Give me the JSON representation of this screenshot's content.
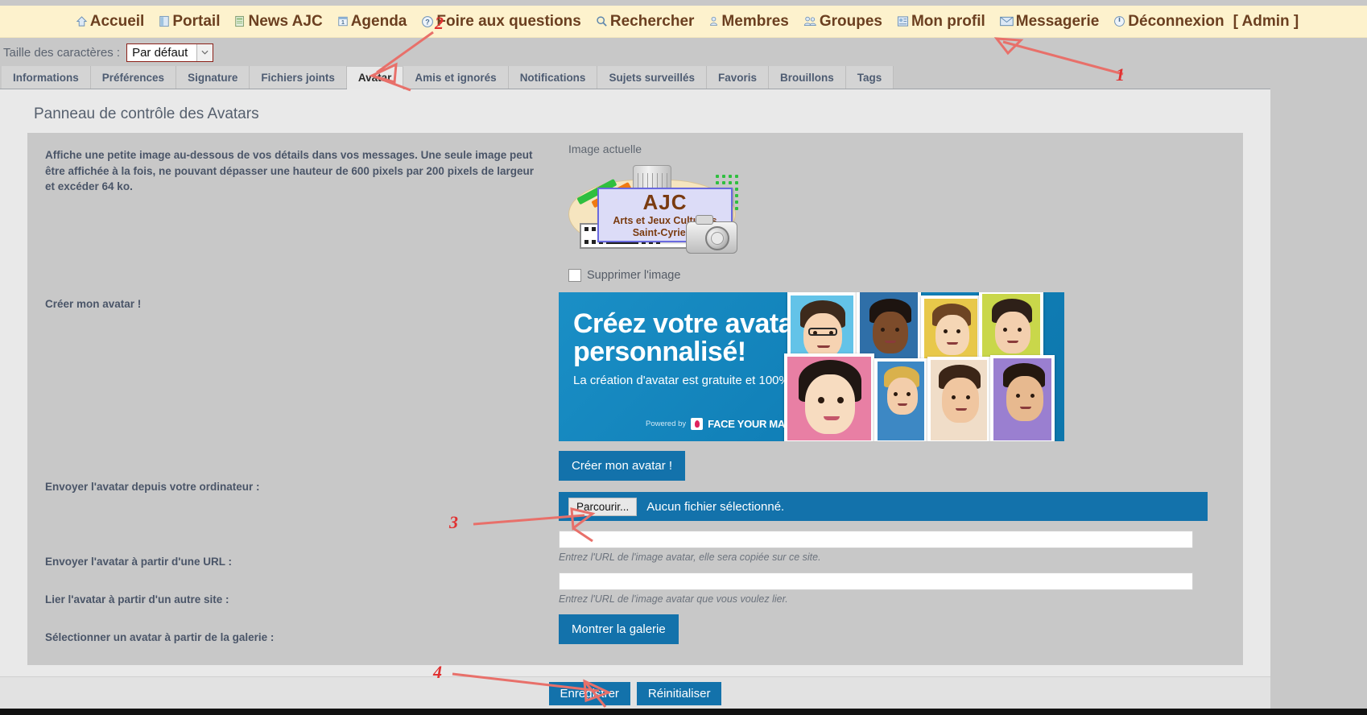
{
  "main_nav": {
    "items": [
      {
        "label": "Accueil",
        "icon": "home-icon",
        "active": false
      },
      {
        "label": "Portail",
        "icon": "portal-icon",
        "active": false
      },
      {
        "label": "News AJC",
        "icon": "news-icon",
        "active": false
      },
      {
        "label": "Agenda",
        "icon": "calendar-icon",
        "active": false
      },
      {
        "label": "Foire aux questions",
        "icon": "question-icon",
        "active": false
      },
      {
        "label": "Rechercher",
        "icon": "search-icon",
        "active": false
      },
      {
        "label": "Membres",
        "icon": "member-icon",
        "active": false
      },
      {
        "label": "Groupes",
        "icon": "groups-icon",
        "active": false
      },
      {
        "label": "Mon profil",
        "icon": "profile-icon",
        "active": true
      },
      {
        "label": "Messagerie",
        "icon": "envelope-icon",
        "active": false
      },
      {
        "label": "Déconnexion",
        "icon": "power-icon",
        "active": false
      }
    ],
    "admin_tag": "[ Admin ]"
  },
  "font_size": {
    "label": "Taille des caractères :",
    "selected": "Par défaut"
  },
  "tabs": [
    {
      "label": "Informations",
      "active": false
    },
    {
      "label": "Préférences",
      "active": false
    },
    {
      "label": "Signature",
      "active": false
    },
    {
      "label": "Fichiers joints",
      "active": false
    },
    {
      "label": "Avatar",
      "active": true
    },
    {
      "label": "Amis et ignorés",
      "active": false
    },
    {
      "label": "Notifications",
      "active": false
    },
    {
      "label": "Sujets surveillés",
      "active": false
    },
    {
      "label": "Favoris",
      "active": false
    },
    {
      "label": "Brouillons",
      "active": false
    },
    {
      "label": "Tags",
      "active": false
    }
  ],
  "page": {
    "title": "Panneau de contrôle des Avatars",
    "info_text": "Affiche une petite image au-dessous de vos détails dans vos messages. Une seule image peut être affichée à la fois, ne pouvant dépasser une hauteur de 600 pixels par 200 pixels de largeur et excéder 64 ko."
  },
  "avatar": {
    "current_label": "Image actuelle",
    "image_alt": "AJC - Arts et Jeux Culturels Saint-Cyriens",
    "logo_line1": "AJC",
    "logo_line2": "Arts et Jeux Culturels",
    "logo_line3": "Saint-Cyriens",
    "delete_checkbox_label": "Supprimer l'image",
    "delete_checked": false
  },
  "banner": {
    "headline_line1": "Créez votre avatar",
    "headline_line2": "personnalisé!",
    "subline": "La création d'avatar est gratuite et 100% Fun",
    "powered_by": "Powered by",
    "brand": "FACE YOUR MANGA",
    "bg_color": "#1180b8"
  },
  "form": {
    "create_avatar_label": "Créer mon avatar !",
    "create_avatar_button": "Créer mon avatar !",
    "upload_computer_label": "Envoyer l'avatar depuis votre ordinateur :",
    "browse_button": "Parcourir...",
    "file_status": "Aucun fichier sélectionné.",
    "upload_url_label": "Envoyer l'avatar à partir d'une URL :",
    "upload_url_value": "",
    "upload_url_hint": "Entrez l'URL de l'image avatar, elle sera copiée sur ce site.",
    "link_url_label": "Lier l'avatar à partir d'un autre site :",
    "link_url_value": "",
    "link_url_hint": "Entrez l'URL de l'image avatar que vous voulez lier.",
    "gallery_label": "Sélectionner un avatar à partir de la galerie :",
    "gallery_button": "Montrer la galerie"
  },
  "footer": {
    "save_button": "Enregistrer",
    "reset_button": "Réinitialiser"
  },
  "annotations": [
    {
      "number": "1"
    },
    {
      "number": "2"
    },
    {
      "number": "3"
    },
    {
      "number": "4"
    }
  ],
  "colors": {
    "nav_bg": "#fdf2cd",
    "nav_text": "#6b3f20",
    "accent_blue": "#1372ab",
    "annotation_red": "#e8706a",
    "panel_bg": "#c8c8c8"
  }
}
